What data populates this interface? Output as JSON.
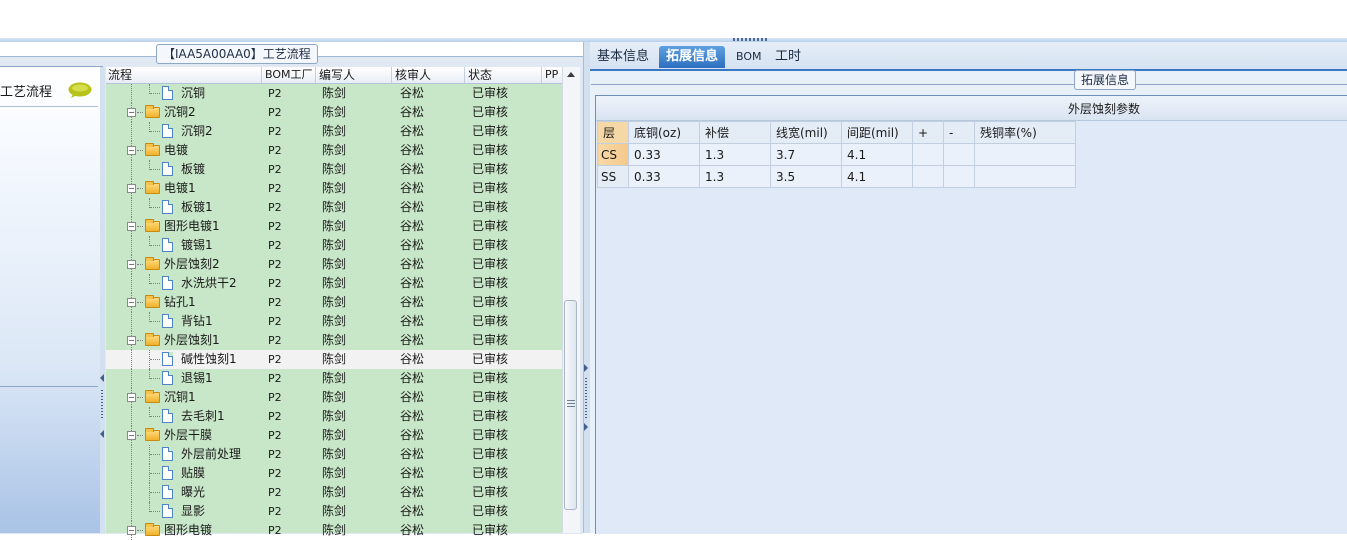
{
  "left_panel": {
    "caption": "【IAA5A00AA0】工艺流程",
    "nav_item": "工艺流程"
  },
  "tree": {
    "columns": [
      "流程",
      "BOM工厂",
      "编写人",
      "核审人",
      "状态",
      "PP"
    ],
    "rows": [
      {
        "name": "沉铜",
        "level": 2,
        "type": "doc",
        "bom": "P2",
        "writer": "陈剑",
        "checker": "谷松",
        "status": "已审核"
      },
      {
        "name": "沉铜2",
        "level": 1,
        "type": "folder",
        "bom": "P2",
        "writer": "陈剑",
        "checker": "谷松",
        "status": "已审核"
      },
      {
        "name": "沉铜2",
        "level": 2,
        "type": "doc",
        "bom": "P2",
        "writer": "陈剑",
        "checker": "谷松",
        "status": "已审核"
      },
      {
        "name": "电镀",
        "level": 1,
        "type": "folder",
        "bom": "P2",
        "writer": "陈剑",
        "checker": "谷松",
        "status": "已审核"
      },
      {
        "name": "板镀",
        "level": 2,
        "type": "doc",
        "bom": "P2",
        "writer": "陈剑",
        "checker": "谷松",
        "status": "已审核"
      },
      {
        "name": "电镀1",
        "level": 1,
        "type": "folder",
        "bom": "P2",
        "writer": "陈剑",
        "checker": "谷松",
        "status": "已审核"
      },
      {
        "name": "板镀1",
        "level": 2,
        "type": "doc",
        "bom": "P2",
        "writer": "陈剑",
        "checker": "谷松",
        "status": "已审核"
      },
      {
        "name": "图形电镀1",
        "level": 1,
        "type": "folder",
        "bom": "P2",
        "writer": "陈剑",
        "checker": "谷松",
        "status": "已审核"
      },
      {
        "name": "镀锡1",
        "level": 2,
        "type": "doc",
        "bom": "P2",
        "writer": "陈剑",
        "checker": "谷松",
        "status": "已审核"
      },
      {
        "name": "外层蚀刻2",
        "level": 1,
        "type": "folder",
        "bom": "P2",
        "writer": "陈剑",
        "checker": "谷松",
        "status": "已审核"
      },
      {
        "name": "水洗烘干2",
        "level": 2,
        "type": "doc",
        "bom": "P2",
        "writer": "陈剑",
        "checker": "谷松",
        "status": "已审核"
      },
      {
        "name": "钻孔1",
        "level": 1,
        "type": "folder",
        "bom": "P2",
        "writer": "陈剑",
        "checker": "谷松",
        "status": "已审核"
      },
      {
        "name": "背钻1",
        "level": 2,
        "type": "doc",
        "bom": "P2",
        "writer": "陈剑",
        "checker": "谷松",
        "status": "已审核"
      },
      {
        "name": "外层蚀刻1",
        "level": 1,
        "type": "folder",
        "bom": "P2",
        "writer": "陈剑",
        "checker": "谷松",
        "status": "已审核"
      },
      {
        "name": "碱性蚀刻1",
        "level": 2,
        "type": "doc",
        "bom": "P2",
        "writer": "陈剑",
        "checker": "谷松",
        "status": "已审核",
        "selected": true
      },
      {
        "name": "退锡1",
        "level": 2,
        "type": "doc",
        "bom": "P2",
        "writer": "陈剑",
        "checker": "谷松",
        "status": "已审核"
      },
      {
        "name": "沉铜1",
        "level": 1,
        "type": "folder",
        "bom": "P2",
        "writer": "陈剑",
        "checker": "谷松",
        "status": "已审核"
      },
      {
        "name": "去毛刺1",
        "level": 2,
        "type": "doc",
        "bom": "P2",
        "writer": "陈剑",
        "checker": "谷松",
        "status": "已审核"
      },
      {
        "name": "外层干膜",
        "level": 1,
        "type": "folder",
        "bom": "P2",
        "writer": "陈剑",
        "checker": "谷松",
        "status": "已审核"
      },
      {
        "name": "外层前处理",
        "level": 2,
        "type": "doc",
        "bom": "P2",
        "writer": "陈剑",
        "checker": "谷松",
        "status": "已审核"
      },
      {
        "name": "贴膜",
        "level": 2,
        "type": "doc",
        "bom": "P2",
        "writer": "陈剑",
        "checker": "谷松",
        "status": "已审核"
      },
      {
        "name": "曝光",
        "level": 2,
        "type": "doc",
        "bom": "P2",
        "writer": "陈剑",
        "checker": "谷松",
        "status": "已审核"
      },
      {
        "name": "显影",
        "level": 2,
        "type": "doc",
        "bom": "P2",
        "writer": "陈剑",
        "checker": "谷松",
        "status": "已审核"
      },
      {
        "name": "图形电镀",
        "level": 1,
        "type": "folder",
        "bom": "P2",
        "writer": "陈剑",
        "checker": "谷松",
        "status": "已审核"
      }
    ]
  },
  "right_panel": {
    "tabs": [
      {
        "label": "基本信息",
        "active": false
      },
      {
        "label": "拓展信息",
        "active": true
      },
      {
        "label": "BOM",
        "active": false
      },
      {
        "label": "工时",
        "active": false
      }
    ],
    "group_caption": "拓展信息",
    "param_title": "外层蚀刻参数",
    "param_table": {
      "headers": [
        "层",
        "底铜(oz)",
        "补偿",
        "线宽(mil)",
        "间距(mil)",
        "+",
        "-",
        "残铜率(%)"
      ],
      "rows": [
        [
          "CS",
          "0.33",
          "1.3",
          "3.7",
          "4.1",
          "",
          "",
          ""
        ],
        [
          "SS",
          "0.33",
          "1.3",
          "3.5",
          "4.1",
          "",
          "",
          ""
        ]
      ]
    }
  },
  "colors": {
    "tree_background": "#c8e6c8",
    "active_tab": "#2e6fc0",
    "selected_row": "#f2f2f2"
  }
}
